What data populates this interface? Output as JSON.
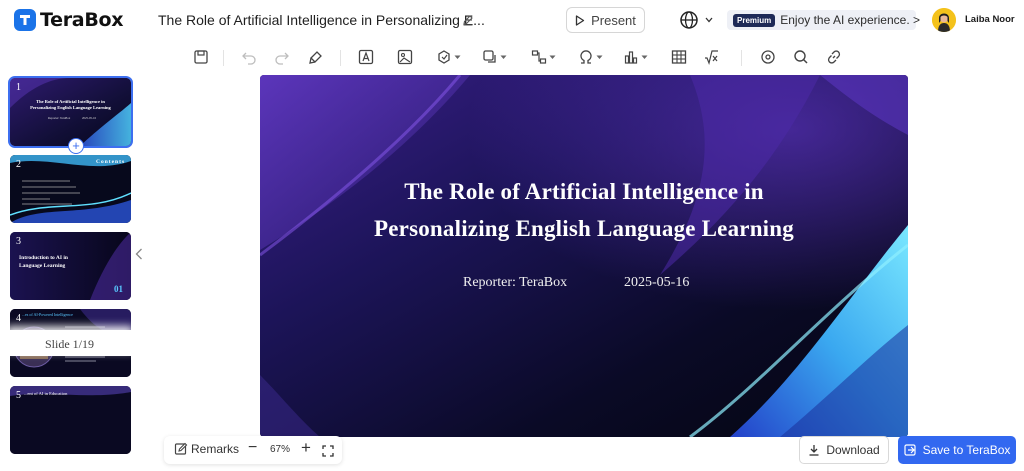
{
  "app": {
    "name": "TeraBox"
  },
  "document": {
    "title": "The Role of Artificial Intelligence in Personalizing E..."
  },
  "header": {
    "present_label": "Present",
    "premium_badge": "Premium",
    "promo_text": "Enjoy the AI experience. >",
    "user_name": "Laiba Noor"
  },
  "toolbar": {
    "icons": [
      "save-icon",
      "undo-icon",
      "redo-icon",
      "format-painter-icon",
      "text-box-icon",
      "image-icon",
      "shape-icon",
      "layout-icon",
      "connector-icon",
      "symbol-icon",
      "chart-icon",
      "table-icon",
      "formula-icon",
      "record-icon",
      "search-icon",
      "link-icon"
    ]
  },
  "slides": {
    "thumbnails": [
      {
        "number": "1",
        "title_line1": "The Role of Artificial Intelligence in",
        "title_line2": "Personalizing English Language Learning",
        "reporter": "Reporter: TeraBox",
        "date": "2025-05-16"
      },
      {
        "number": "2",
        "heading": "Contents"
      },
      {
        "number": "3",
        "title_line1": "Introduction to AI in",
        "title_line2": "Language Learning",
        "section": "01"
      },
      {
        "number": "4",
        "heading": "...es of AI-Powered Intelligence"
      },
      {
        "number": "5",
        "heading": "...ent of AI in Education"
      }
    ],
    "counter": "Slide 1/19"
  },
  "main_slide": {
    "title_line1": "The Role of Artificial Intelligence in",
    "title_line2": "Personalizing English Language Learning",
    "reporter": "Reporter: TeraBox",
    "date": "2025-05-16"
  },
  "bottom": {
    "remarks_label": "Remarks",
    "zoom": "67%",
    "download_label": "Download",
    "save_label": "Save to TeraBox"
  },
  "colors": {
    "accent": "#3268f0",
    "slide_bg": "#07071a",
    "slide_purple": "#4a2a9a",
    "slide_cyan": "#3fb8f5"
  }
}
